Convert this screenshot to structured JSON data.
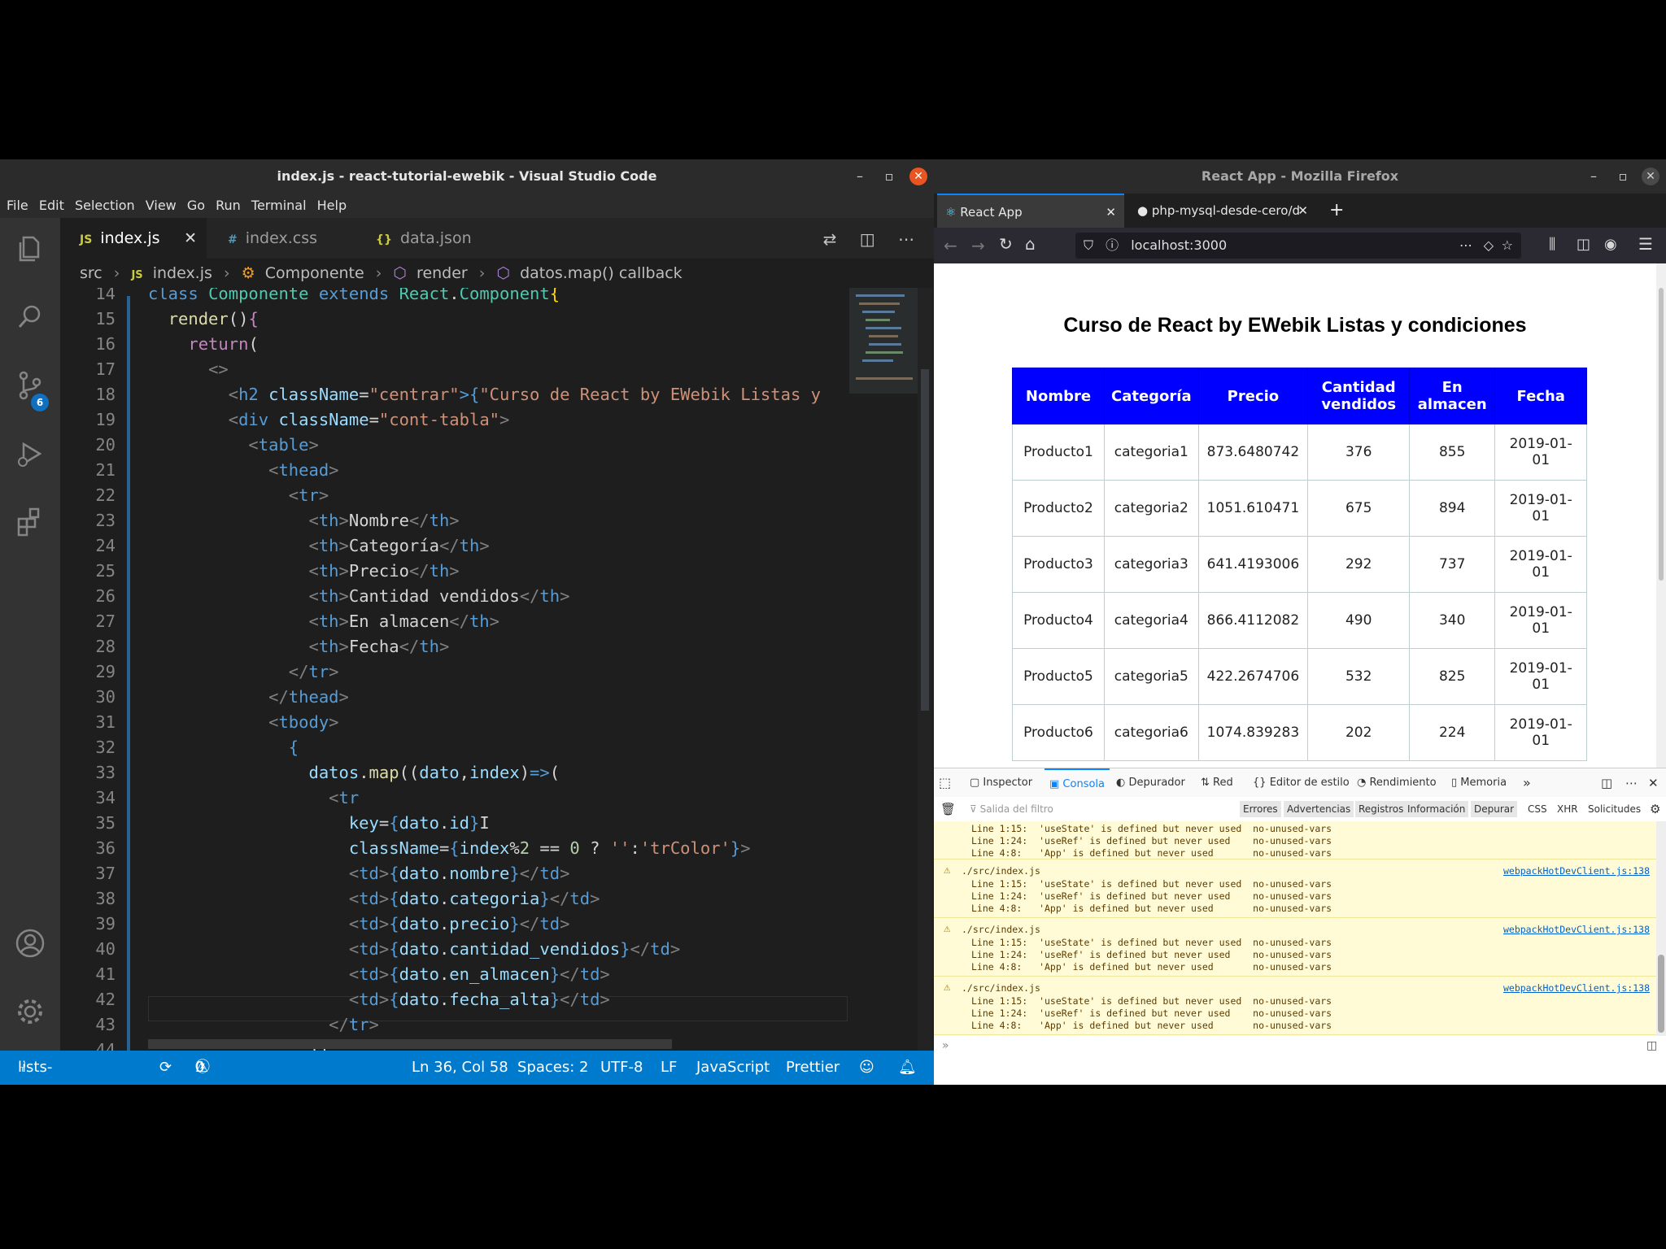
{
  "vscode": {
    "window_title": "index.js - react-tutorial-ewebik - Visual Studio Code",
    "menu": [
      "File",
      "Edit",
      "Selection",
      "View",
      "Go",
      "Run",
      "Terminal",
      "Help"
    ],
    "scm_badge": "6",
    "tabs": [
      {
        "icon": "JS",
        "label": "index.js",
        "close": "✕"
      },
      {
        "icon": "#",
        "label": "index.css"
      },
      {
        "icon": "{}",
        "label": "data.json"
      }
    ],
    "breadcrumb": [
      "src",
      "index.js",
      "Componente",
      "render",
      "datos.map() callback"
    ],
    "breadcrumb_js_icon": "JS",
    "status": {
      "branch": "lists-and-keys*",
      "errors": "0",
      "warnings": "0",
      "position": "Ln 36, Col 58",
      "spaces": "Spaces: 2",
      "encoding": "UTF-8",
      "eol": "LF",
      "language": "JavaScript",
      "formatter": "Prettier"
    },
    "line_numbers": [
      "14",
      "15",
      "16",
      "17",
      "18",
      "19",
      "20",
      "21",
      "22",
      "23",
      "24",
      "25",
      "26",
      "27",
      "28",
      "29",
      "30",
      "31",
      "32",
      "33",
      "34",
      "35",
      "36",
      "37",
      "38",
      "39",
      "40",
      "41",
      "42",
      "43",
      "44"
    ]
  },
  "firefox": {
    "window_title": "React App - Mozilla Firefox",
    "tabs": [
      {
        "label": "React App",
        "close": "✕"
      },
      {
        "label": "php-mysql-desde-cero/d",
        "close": "✕"
      }
    ],
    "new_tab": "+",
    "url": "localhost:3000",
    "page_title": "Curso de React by EWebik Listas y condiciones",
    "table_headers": [
      "Nombre",
      "Categoría",
      "Precio",
      "Cantidad vendidos",
      "En almacen",
      "Fecha"
    ],
    "table_rows": [
      [
        "Producto1",
        "categoria1",
        "873.6480742",
        "376",
        "855",
        "2019-01-01"
      ],
      [
        "Producto2",
        "categoria2",
        "1051.610471",
        "675",
        "894",
        "2019-01-01"
      ],
      [
        "Producto3",
        "categoria3",
        "641.4193006",
        "292",
        "737",
        "2019-01-01"
      ],
      [
        "Producto4",
        "categoria4",
        "866.4112082",
        "490",
        "340",
        "2019-01-01"
      ],
      [
        "Producto5",
        "categoria5",
        "422.2674706",
        "532",
        "825",
        "2019-01-01"
      ],
      [
        "Producto6",
        "categoria6",
        "1074.839283",
        "202",
        "224",
        "2019-01-01"
      ]
    ],
    "devtools": {
      "tabs": [
        "Inspector",
        "Consola",
        "Depurador",
        "Red",
        "Editor de estilo",
        "Rendimiento",
        "Memoria"
      ],
      "filter_placeholder": "Salida del filtro",
      "filters": [
        "Errores",
        "Advertencias",
        "Registros",
        "Información",
        "Depurar"
      ],
      "filters_right": [
        "CSS",
        "XHR",
        "Solicitudes"
      ],
      "log_lines": [
        "Line 1:15:  'useState' is defined but never used  no-unused-vars",
        "Line 1:24:  'useRef' is defined but never used    no-unused-vars",
        "Line 4:8:   'App' is defined but never used       no-unused-vars"
      ],
      "log_source": "./src/index.js",
      "log_link": "webpackHotDevClient.js:138"
    }
  }
}
